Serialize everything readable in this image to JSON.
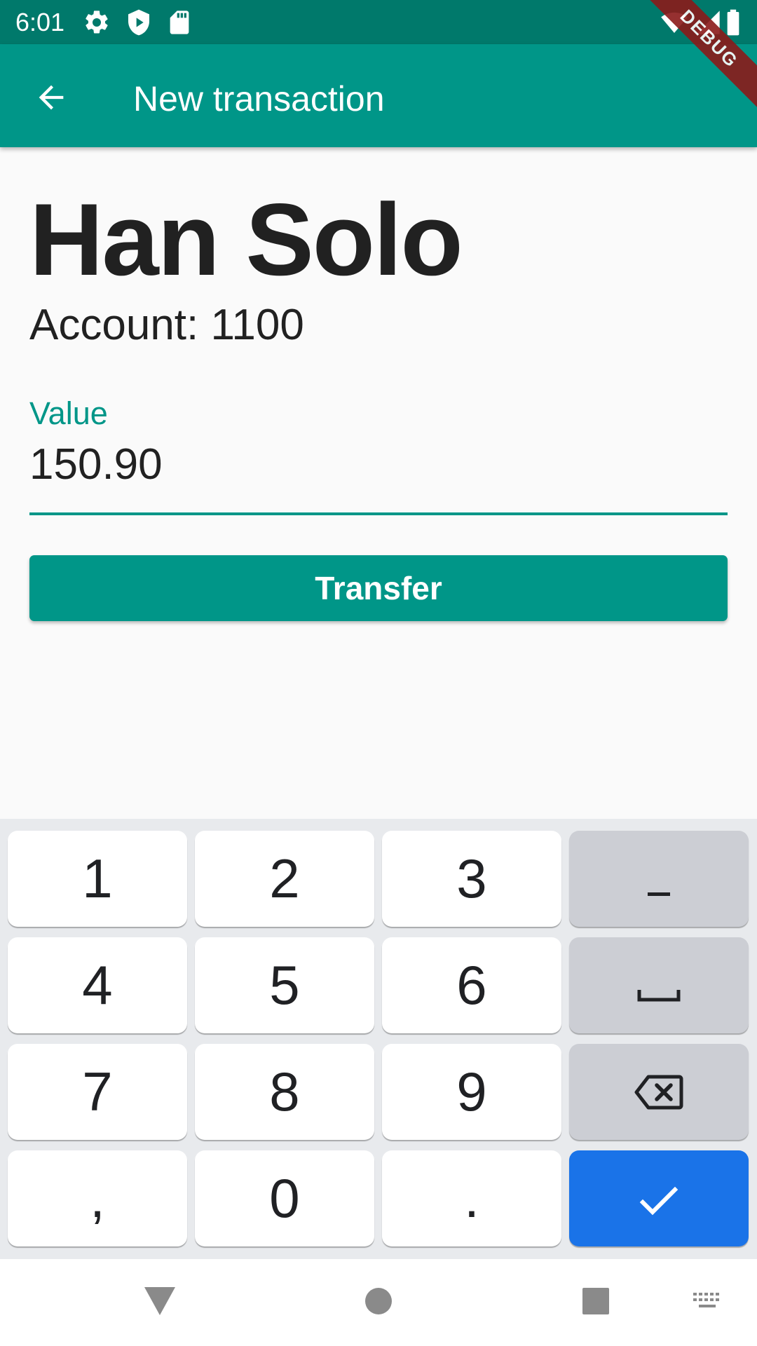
{
  "status_bar": {
    "time": "6:01",
    "icons": [
      "gear-icon",
      "shield-play-icon",
      "sd-card-icon",
      "wifi-icon",
      "signal-icon",
      "battery-icon"
    ]
  },
  "debug_banner": "DEBUG",
  "app_bar": {
    "title": "New transaction",
    "back_icon": "arrow-back-icon"
  },
  "contact": {
    "name": "Han Solo",
    "account_text": "Account: 1100"
  },
  "value_field": {
    "label": "Value",
    "value": "150.90"
  },
  "transfer_button": {
    "label": "Transfer"
  },
  "keyboard": {
    "rows": [
      [
        "1",
        "2",
        "3",
        "-"
      ],
      [
        "4",
        "5",
        "6",
        "space"
      ],
      [
        "7",
        "8",
        "9",
        "backspace"
      ],
      [
        ",",
        "0",
        ".",
        "done"
      ]
    ]
  },
  "nav_bar": {
    "icons": [
      "back-triangle-icon",
      "home-circle-icon",
      "recents-square-icon",
      "keyboard-icon"
    ]
  },
  "colors": {
    "primary": "#009688",
    "primary_dark": "#00796b",
    "keyboard_accent": "#1a73e8",
    "background": "#fafafa"
  }
}
